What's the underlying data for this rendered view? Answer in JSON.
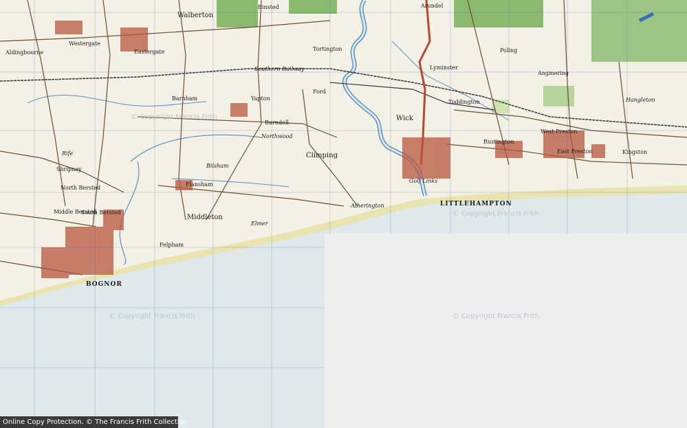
{
  "map": {
    "colors": {
      "land": "#f3f1e6",
      "sea": "#dfe9ec",
      "beach": "#e9e3b0",
      "road_main": "#b9462f",
      "road_minor": "#6b4e2f",
      "woods": "#77b05a",
      "water": "#5a8fbf",
      "town": "#b8553d",
      "blank": "#eeeeee"
    },
    "places": [
      {
        "name": "Walberton",
        "cls": "md"
      },
      {
        "name": "Binsted",
        "cls": "sm"
      },
      {
        "name": "Arundel",
        "cls": "sm"
      },
      {
        "name": "Westergate",
        "cls": "sm"
      },
      {
        "name": "Aldingbourne",
        "cls": "sm"
      },
      {
        "name": "Eastergate",
        "cls": "sm"
      },
      {
        "name": "Barnham",
        "cls": "sm"
      },
      {
        "name": "Yapton",
        "cls": "sm"
      },
      {
        "name": "Ford",
        "cls": "sm"
      },
      {
        "name": "Tortington",
        "cls": "sm"
      },
      {
        "name": "Burndell",
        "cls": "sm"
      },
      {
        "name": "Northwood",
        "cls": "it"
      },
      {
        "name": "Climping",
        "cls": "md"
      },
      {
        "name": "Bilsham",
        "cls": "it"
      },
      {
        "name": "Flansham",
        "cls": "sm"
      },
      {
        "name": "North Bersted",
        "cls": "sm"
      },
      {
        "name": "Middle Bersted",
        "cls": "sm"
      },
      {
        "name": "South Bersted",
        "cls": "sm"
      },
      {
        "name": "Shripney",
        "cls": "sm"
      },
      {
        "name": "Middleton",
        "cls": "md"
      },
      {
        "name": "Felpham",
        "cls": "sm"
      },
      {
        "name": "BOGNOR",
        "cls": "town"
      },
      {
        "name": "Elmer",
        "cls": "it"
      },
      {
        "name": "Atherington",
        "cls": "it"
      },
      {
        "name": "Wick",
        "cls": "md"
      },
      {
        "name": "Lyminster",
        "cls": "sm"
      },
      {
        "name": "Toddington",
        "cls": "sm"
      },
      {
        "name": "Poling",
        "cls": "sm"
      },
      {
        "name": "Angmering",
        "cls": "sm"
      },
      {
        "name": "Rustington",
        "cls": "sm"
      },
      {
        "name": "West Preston",
        "cls": "sm"
      },
      {
        "name": "East Preston",
        "cls": "sm"
      },
      {
        "name": "Kingston",
        "cls": "sm"
      },
      {
        "name": "Hangleton",
        "cls": "it"
      },
      {
        "name": "LITTLEHAMPTON",
        "cls": "town"
      },
      {
        "name": "Golf Links",
        "cls": "it"
      },
      {
        "name": "Southern Railway",
        "cls": "it"
      },
      {
        "name": "Rife",
        "cls": "it"
      }
    ],
    "watermark": "© Copyright Francis Frith",
    "footer": "Online Copy Protection. © The Francis Frith Collection"
  }
}
